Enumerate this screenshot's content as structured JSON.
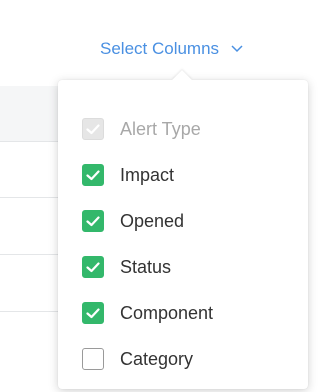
{
  "trigger": {
    "label": "Select Columns",
    "icon": "chevron-down-icon",
    "color": "#4a90e2"
  },
  "options": [
    {
      "label": "Alert Type",
      "checked": true,
      "disabled": true
    },
    {
      "label": "Impact",
      "checked": true,
      "disabled": false
    },
    {
      "label": "Opened",
      "checked": true,
      "disabled": false
    },
    {
      "label": "Status",
      "checked": true,
      "disabled": false
    },
    {
      "label": "Component",
      "checked": true,
      "disabled": false
    },
    {
      "label": "Category",
      "checked": false,
      "disabled": false
    }
  ],
  "colors": {
    "checked": "#33b86b",
    "disabled": "#e6e6e6"
  }
}
